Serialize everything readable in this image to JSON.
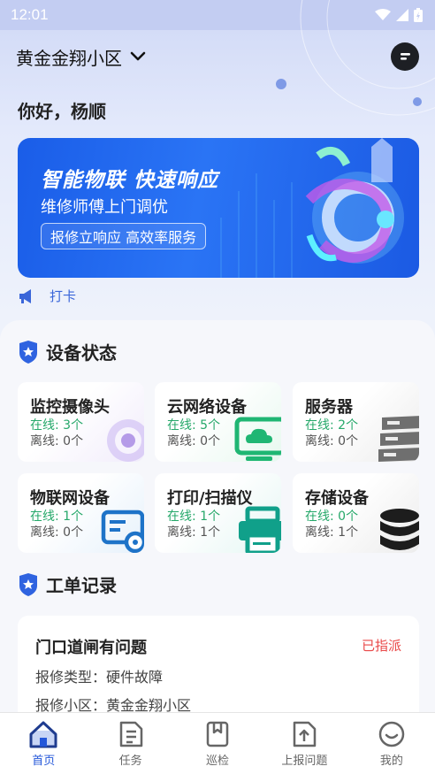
{
  "status_bar": {
    "time": "12:01"
  },
  "header": {
    "community": "黄金金翔小区"
  },
  "greeting": "你好，杨顺",
  "banner": {
    "title": "智能物联  快速响应",
    "subtitle": "维修师傅上门调优",
    "tag": "报修立响应 高效率服务"
  },
  "notice": {
    "text": "打卡"
  },
  "device_section": {
    "title": "设备状态",
    "devices": [
      {
        "name": "监控摄像头",
        "online": "在线: 3个",
        "offline": "离线: 0个",
        "icon": "camera-icon"
      },
      {
        "name": "云网络设备",
        "online": "在线: 5个",
        "offline": "离线: 0个",
        "icon": "cloud-monitor-icon"
      },
      {
        "name": "服务器",
        "online": "在线: 2个",
        "offline": "离线: 0个",
        "icon": "server-icon"
      },
      {
        "name": "物联网设备",
        "online": "在线: 1个",
        "offline": "离线: 0个",
        "icon": "iot-card-icon"
      },
      {
        "name": "打印/扫描仪",
        "online": "在线: 1个",
        "offline": "离线: 1个",
        "icon": "printer-icon"
      },
      {
        "name": "存储设备",
        "online": "在线: 0个",
        "offline": "离线: 1个",
        "icon": "database-icon"
      }
    ]
  },
  "order_section": {
    "title": "工单记录",
    "order": {
      "title": "门口道闸有问题",
      "status": "已指派",
      "type_label": "报修类型：",
      "type_value": "硬件故障",
      "community_label": "报修小区：",
      "community_value": "黄金金翔小区"
    }
  },
  "tabbar": {
    "tabs": [
      {
        "label": "首页",
        "icon": "home-icon",
        "active": true
      },
      {
        "label": "任务",
        "icon": "task-icon"
      },
      {
        "label": "巡检",
        "icon": "inspection-icon"
      },
      {
        "label": "上报问题",
        "icon": "report-icon"
      },
      {
        "label": "我的",
        "icon": "profile-icon"
      }
    ]
  },
  "colors": {
    "accent": "#2457d9",
    "online": "#26a86a",
    "status_assigned": "#e94848"
  }
}
